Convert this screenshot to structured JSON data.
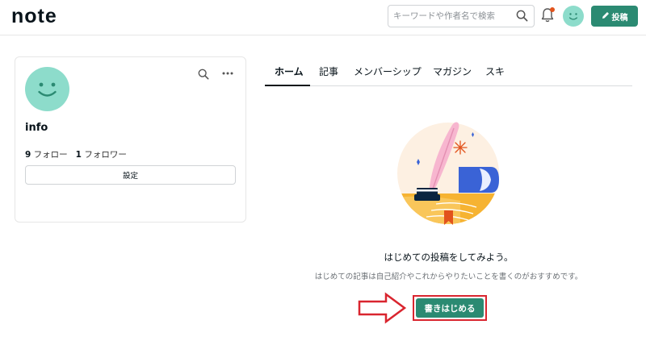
{
  "header": {
    "logo": "note",
    "search_placeholder": "キーワードや作者名で検索",
    "post_label": "投稿",
    "accent_color": "#2b8a72",
    "notification_dot_color": "#e2531c"
  },
  "profile": {
    "name": "info",
    "following_count": "9",
    "following_label": "フォロー",
    "followers_count": "1",
    "followers_label": "フォロワー",
    "settings_label": "設定",
    "avatar_icon": "smiley-face-icon"
  },
  "tabs": [
    {
      "label": "ホーム",
      "active": true
    },
    {
      "label": "記事",
      "active": false
    },
    {
      "label": "メンバーシップ",
      "active": false
    },
    {
      "label": "マガジン",
      "active": false
    },
    {
      "label": "スキ",
      "active": false
    }
  ],
  "empty_state": {
    "title": "はじめての投稿をしてみよう。",
    "subtitle": "はじめての記事は自己紹介やこれからやりたいことを書くのがおすすめです。",
    "button_label": "書きはじめる",
    "highlight_color": "#d9252f"
  }
}
